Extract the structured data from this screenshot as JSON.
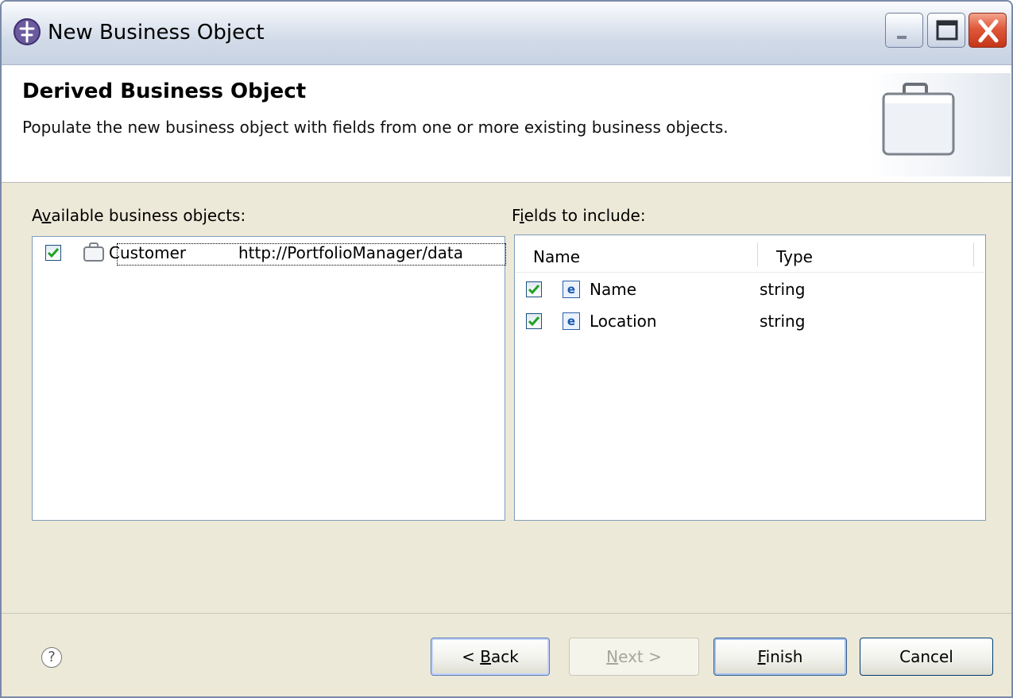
{
  "window": {
    "title": "New Business Object"
  },
  "header": {
    "title": "Derived Business Object",
    "description": "Populate the new business object with fields from one or more existing business objects."
  },
  "available": {
    "label_prefix": "A",
    "label_mnemonic": "v",
    "label_rest": "ailable business objects:",
    "items": [
      {
        "checked": true,
        "icon": "business-object-icon",
        "name": "Customer",
        "namespace": "http://PortfolioManager/data"
      }
    ]
  },
  "fields": {
    "label_prefix": "F",
    "label_mnemonic": "i",
    "label_rest": "elds to include:",
    "columns": [
      "Name",
      "Type"
    ],
    "rows": [
      {
        "checked": true,
        "icon": "element-icon",
        "icon_glyph": "e",
        "name": "Name",
        "type": "string"
      },
      {
        "checked": true,
        "icon": "element-icon",
        "icon_glyph": "e",
        "name": "Location",
        "type": "string"
      }
    ]
  },
  "footer": {
    "help_glyph": "?",
    "back": {
      "prefix": "< ",
      "mnemonic": "B",
      "rest": "ack"
    },
    "next": {
      "prefix": "",
      "mnemonic": "N",
      "rest": "ext >"
    },
    "finish": {
      "prefix": "",
      "mnemonic": "F",
      "rest": "inish"
    },
    "cancel": "Cancel"
  },
  "colors": {
    "dialog_bg": "#ece9d8",
    "border_blue": "#7f9db9",
    "check_green": "#21a121",
    "close_red": "#d9482a"
  }
}
